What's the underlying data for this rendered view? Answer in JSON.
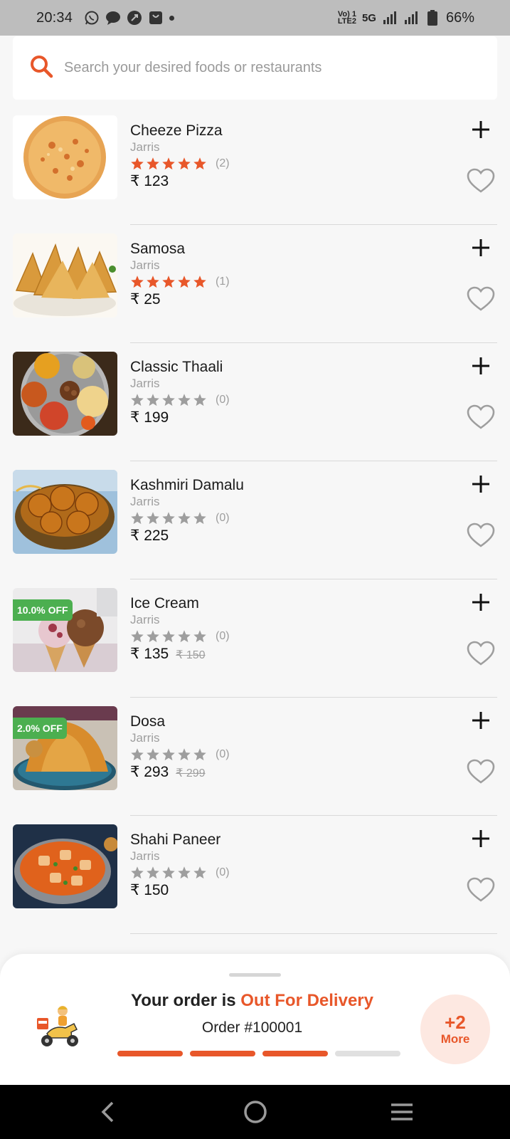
{
  "status_bar": {
    "time": "20:34",
    "network_label_top": "Vo) 1",
    "network_label_bottom": "LTE2",
    "network_type": "5G",
    "battery_percent": "66%",
    "icons": [
      "whatsapp-icon",
      "message-icon",
      "chat-icon",
      "shopping-bag-icon",
      "dot-icon",
      "signal-icon",
      "signal-icon",
      "battery-icon"
    ]
  },
  "search": {
    "placeholder": "Search your desired foods or restaurants",
    "icon": "search-icon"
  },
  "colors": {
    "accent": "#e8572a",
    "discount_badge": "#4caf50",
    "star_filled": "#e8572a",
    "star_empty": "#9e9e9e"
  },
  "currency": "₹",
  "foods": [
    {
      "name": "Cheeze Pizza",
      "restaurant": "Jarris",
      "rating": 5,
      "rating_count": "(2)",
      "price": "₹ 123",
      "old_price": "",
      "discount": "",
      "image": "pizza-image"
    },
    {
      "name": "Samosa",
      "restaurant": "Jarris",
      "rating": 5,
      "rating_count": "(1)",
      "price": "₹ 25",
      "old_price": "",
      "discount": "",
      "image": "samosa-image"
    },
    {
      "name": "Classic Thaali",
      "restaurant": "Jarris",
      "rating": 0,
      "rating_count": "(0)",
      "price": "₹ 199",
      "old_price": "",
      "discount": "",
      "image": "thaali-image"
    },
    {
      "name": "Kashmiri Damalu",
      "restaurant": "Jarris",
      "rating": 0,
      "rating_count": "(0)",
      "price": "₹ 225",
      "old_price": "",
      "discount": "",
      "image": "damalu-image"
    },
    {
      "name": "Ice Cream",
      "restaurant": "Jarris",
      "rating": 0,
      "rating_count": "(0)",
      "price": "₹ 135",
      "old_price": "₹ 150",
      "discount": "10.0% OFF",
      "image": "ice-cream-image"
    },
    {
      "name": "Dosa",
      "restaurant": "Jarris",
      "rating": 0,
      "rating_count": "(0)",
      "price": "₹ 293",
      "old_price": "₹ 299",
      "discount": "2.0% OFF",
      "image": "dosa-image"
    },
    {
      "name": "Shahi Paneer",
      "restaurant": "Jarris",
      "rating": 0,
      "rating_count": "(0)",
      "price": "₹ 150",
      "old_price": "",
      "discount": "",
      "image": "paneer-image"
    }
  ],
  "order": {
    "status_prefix": "Your order is ",
    "status_highlight": "Out For Delivery",
    "order_number": "Order #100001",
    "progress_steps_total": 4,
    "progress_steps_done": 3,
    "more_count": "+2",
    "more_label": "More",
    "illustration": "delivery-scooter-icon"
  },
  "nav": {
    "back": "back-icon",
    "home": "home-icon",
    "menu": "menu-icon"
  }
}
